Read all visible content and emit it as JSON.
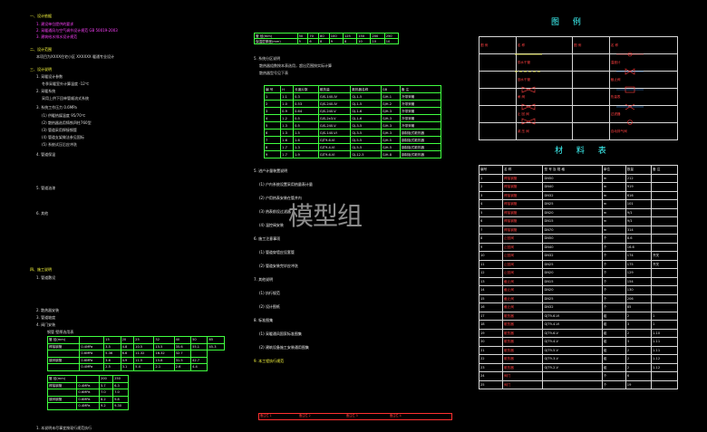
{
  "left": {
    "heads": [
      "一、设计依据",
      "二、设计范围",
      "三、设计说明",
      "四、施工说明"
    ],
    "lines": [
      {
        "t": "1. 建设单位提供的要求",
        "c": "m"
      },
      {
        "t": "2. 采暖通风与空气调节设计规范 GB 50019-2003",
        "c": "m"
      },
      {
        "t": "3. 建筑给水排水设计规范",
        "c": "m"
      },
      {
        "t": "本项目为XXXX住宅小区 XXXXXX 暖通专业设计",
        "c": "w"
      },
      {
        "t": "1. 采暖设计参数",
        "c": "w"
      },
      {
        "t": "冬季采暖室外计算温度 -12℃",
        "c": "w"
      },
      {
        "t": "2. 采暖系统",
        "c": "w"
      },
      {
        "t": "采用上供下回单管顺流式系统",
        "c": "w"
      },
      {
        "t": "3. 系统工作压力 0.6MPa",
        "c": "w"
      },
      {
        "t": "(1) 供暖热媒温度 95/70℃",
        "c": "w"
      },
      {
        "t": "(2) 散热器选用铸铁四柱760型",
        "c": "w"
      },
      {
        "t": "(3) 管道采用焊接钢管",
        "c": "w"
      },
      {
        "t": "(4) 管道支架做法参见国标",
        "c": "w"
      },
      {
        "t": "(5) 系统试压后应冲洗",
        "c": "w"
      },
      {
        "t": "4. 管道保温",
        "c": "w"
      },
      {
        "t": "5. 管道油漆",
        "c": "w"
      },
      {
        "t": "6. 其他",
        "c": "w"
      },
      {
        "t": "1. 管道敷设",
        "c": "w"
      },
      {
        "t": "2. 散热器安装",
        "c": "w"
      },
      {
        "t": "3. 管道坡度",
        "c": "w"
      },
      {
        "t": "4. 阀门安装",
        "c": "w"
      },
      {
        "t": "钢管 壁厚选用表",
        "c": "w"
      }
    ],
    "t1": {
      "head": [
        "管 径(mm)",
        "",
        "15",
        "20",
        "25",
        "32",
        "40",
        "50",
        "65"
      ],
      "rows": [
        [
          "焊接钢管",
          "0.4MPa",
          "3.5",
          "4.8",
          "10.5",
          "15.5",
          "35.6",
          "55.1",
          "45.3"
        ],
        [
          "",
          "0.6MPa",
          "5.36",
          "6.6",
          "11.32",
          "16.32",
          "32.7",
          ""
        ],
        [
          "镀锌钢管",
          "0.6MPa",
          "3.6",
          "4.9",
          "11.5",
          "15.8",
          "31.5",
          "42.7"
        ],
        [
          "",
          "0.4MPa",
          "2.5",
          "3.1",
          "5.4",
          "2.1",
          "2.6",
          "4.4"
        ]
      ]
    },
    "t2": {
      "head": [
        "管 径(mm)",
        "",
        "200",
        "250"
      ],
      "rows": [
        [
          "焊接钢管",
          "0.4MPa",
          "5.7",
          "6.3"
        ],
        [
          "",
          "0.6MPa",
          "7.0",
          "7.0"
        ],
        [
          "镀锌钢管",
          "0.6MPa",
          "8.2",
          "9.8"
        ],
        [
          "",
          "0.4MPa",
          "9.2",
          "9.30"
        ]
      ]
    },
    "foot": "1. 本说明未尽事宜按现行规范执行"
  },
  "middle": {
    "top": {
      "head": [
        "管 径(mm)",
        "50",
        "70",
        "80",
        "100",
        "125",
        "150",
        "200",
        "250"
      ],
      "row": [
        "保温层厚度(mm)",
        "5",
        "6",
        "8",
        "9",
        "8",
        "10",
        "10",
        "10"
      ]
    },
    "s5": "5. 系统分区说明",
    "s5a": "散热器组数按本表选用，超出范围按实际计算",
    "s5b": "散热器型号见下表",
    "rad": {
      "head": [
        "编 号",
        "H",
        "长度片数",
        "散热量",
        "散热器名称",
        "GB",
        "备 注"
      ],
      "rows": [
        [
          "1",
          "1.1",
          "0.3",
          "GJS-140-IV",
          "GJ-1-5",
          "GJH-1",
          "冷带采暖"
        ],
        [
          "2",
          "1.0",
          "0.53",
          "GJS-240-IV",
          "GJ-1-5",
          "GJH-2",
          "冷带采暖"
        ],
        [
          "3",
          "0.9",
          "0.64",
          "GJS-240-V",
          "GJ-1-6",
          "GJH-3",
          "冷带采暖"
        ],
        [
          "4",
          "1.2",
          "0.5",
          "GJS-2x3-V",
          "GJ-1-6",
          "GJH-3",
          "冷带采暖"
        ],
        [
          "5",
          "1.3",
          "0.5",
          "GJS-240-V",
          "GJ-3-5",
          "GJH-3",
          "冷带采暖"
        ],
        [
          "6",
          "1.3",
          "1.5",
          "GJS-140-VI",
          "GJ-3-5",
          "GJH-3",
          "钢制板式散热器"
        ],
        [
          "7",
          "1.6",
          "1.6",
          "GJT9-6-VI",
          "GJ-5-5",
          "GJH-5",
          "钢制板式散热器"
        ],
        [
          "8",
          "1.7",
          "1.3",
          "GJT9-4-VI",
          "GJ-5-5",
          "GJH-5",
          "钢制板式散热器"
        ],
        [
          "9",
          "1.7",
          "1.9",
          "GJT9-6-VI",
          "GJ-12-5",
          "GJH-8",
          "钢制板式散热器"
        ]
      ]
    },
    "notes": [
      {
        "t": "5. 进户计量装置说明",
        "c": "w"
      },
      {
        "t": "(1) 户内系统设置采用热量表计量",
        "c": "w"
      },
      {
        "t": "(2) 户用热表安装在管井内",
        "c": "w"
      },
      {
        "t": "(3) 热表前设过滤器",
        "c": "w"
      },
      {
        "t": "(4) 温控阀安装",
        "c": "w"
      },
      {
        "t": "6. 施工注意事项",
        "c": "w"
      },
      {
        "t": "(1) 管道穿墙应设套管",
        "c": "w"
      },
      {
        "t": "(2) 管道安装完毕应冲洗",
        "c": "w"
      },
      {
        "t": "7. 其他说明",
        "c": "w"
      },
      {
        "t": "(1) 执行规范",
        "c": "w"
      },
      {
        "t": "(2) 设计图纸",
        "c": "w"
      },
      {
        "t": "8. 标准图集",
        "c": "w"
      },
      {
        "t": "(1) 采暖通风国家标准图集",
        "c": "w"
      },
      {
        "t": "(2) 建筑设备施工安装通用图集",
        "c": "w"
      },
      {
        "t": "9. 本工程执行规范",
        "c": "y"
      }
    ],
    "stamp": [
      "备注栏 1",
      "备注栏 2",
      "备注栏 3",
      "备注栏 4"
    ]
  },
  "legend": {
    "title": "图 例",
    "head": [
      "图 例",
      "名 称",
      "图 例",
      "名 称"
    ],
    "rows": [
      [
        "",
        "供水干管",
        "",
        "温度计"
      ],
      [
        "",
        "回水干管",
        "",
        "截止阀"
      ],
      [
        "",
        "闸 阀",
        "",
        "热量表"
      ],
      [
        "",
        "止 回 阀",
        "",
        "过滤器"
      ],
      [
        "",
        "减 压 阀",
        "",
        "自动排气阀"
      ]
    ]
  },
  "materials": {
    "title": "材 料 表",
    "head": [
      "编号",
      "名 称",
      "型 号 及 规 格",
      "单位",
      "数量",
      "备 注"
    ],
    "rows": [
      [
        "1",
        "焊接钢管",
        "DN50",
        "m",
        "212",
        ""
      ],
      [
        "2",
        "焊接钢管",
        "DN40",
        "m",
        "919",
        ""
      ],
      [
        "3",
        "焊接钢管",
        "DN32",
        "m",
        "616",
        ""
      ],
      [
        "4",
        "焊接钢管",
        "DN25",
        "m",
        "101",
        ""
      ],
      [
        "5",
        "焊接钢管",
        "DN20",
        "m",
        "9/1",
        ""
      ],
      [
        "6",
        "焊接钢管",
        "DN15",
        "m",
        "9/1",
        ""
      ],
      [
        "7",
        "焊接钢管",
        "DN70",
        "m",
        "314",
        ""
      ],
      [
        "8",
        "止回阀",
        "DN50",
        "个",
        "8.6",
        ""
      ],
      [
        "9",
        "止回阀",
        "DN40",
        "个",
        "16.6",
        ""
      ],
      [
        "10",
        "止回阀",
        "DN32",
        "个",
        "174",
        "开关"
      ],
      [
        "11",
        "止回阀",
        "DN25",
        "个",
        "175",
        "开关"
      ],
      [
        "12",
        "止回阀",
        "DN20",
        "个",
        "129",
        ""
      ],
      [
        "13",
        "截止阀",
        "DN15",
        "个",
        "154",
        ""
      ],
      [
        "14",
        "截止阀",
        "DN20",
        "个",
        "130",
        ""
      ],
      [
        "15",
        "截止阀",
        "DN25",
        "个",
        "206",
        ""
      ],
      [
        "16",
        "截止阀",
        "DN32",
        "个",
        "85",
        ""
      ],
      [
        "17",
        "散热器",
        "GJT9-6-VI",
        "组",
        "2",
        "1"
      ],
      [
        "18",
        "散热器",
        "GJT9-4-VI",
        "组",
        "3",
        "1"
      ],
      [
        "19",
        "散热器",
        "GJT9-6-V",
        "组",
        "2",
        "1-10"
      ],
      [
        "20",
        "散热器",
        "GJT9-4-V",
        "组",
        "3",
        "1-11"
      ],
      [
        "21",
        "散热器",
        "GJT9-5-V",
        "组",
        "2",
        "1-11"
      ],
      [
        "22",
        "散热器",
        "GJT9-3-V",
        "组",
        "2",
        "1-12"
      ],
      [
        "23",
        "散热器",
        "GJT9-2-V",
        "组",
        "2",
        "1-12"
      ],
      [
        "24",
        "阀门",
        "",
        "个",
        "6",
        ""
      ],
      [
        "25",
        "阀门",
        "",
        "个",
        "19",
        ""
      ]
    ]
  },
  "watermark": "模型组"
}
